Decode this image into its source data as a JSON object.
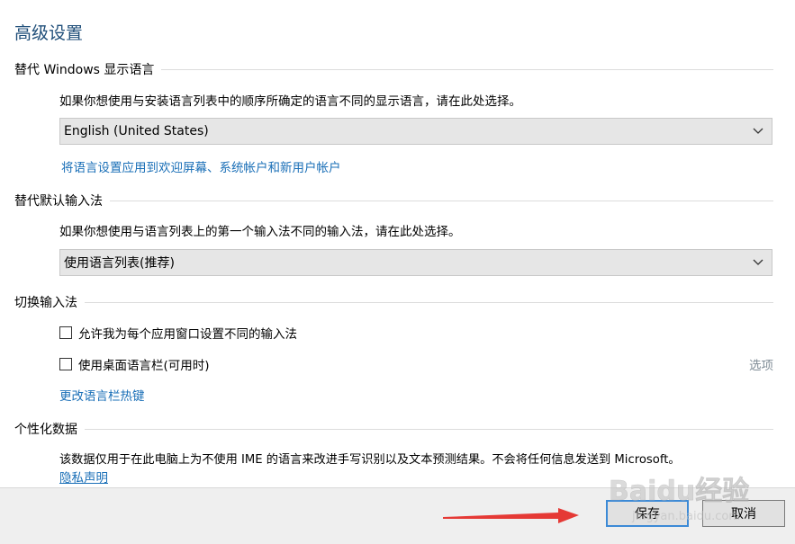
{
  "page": {
    "title": "高级设置"
  },
  "display_language": {
    "header": "替代 Windows 显示语言",
    "description": "如果你想使用与安装语言列表中的顺序所确定的语言不同的显示语言，请在此处选择。",
    "selected": "English (United States)",
    "apply_link": "将语言设置应用到欢迎屏幕、系统帐户和新用户帐户"
  },
  "default_input": {
    "header": "替代默认输入法",
    "description": "如果你想使用与语言列表上的第一个输入法不同的输入法，请在此处选择。",
    "selected": "使用语言列表(推荐)"
  },
  "switch_input": {
    "header": "切换输入法",
    "option1_label": "允许我为每个应用窗口设置不同的输入法",
    "option1_checked": false,
    "option2_label": "使用桌面语言栏(可用时)",
    "option2_checked": false,
    "options_link": "选项",
    "hotkey_link": "更改语言栏热键"
  },
  "personalization": {
    "header": "个性化数据",
    "description": "该数据仅用于在此电脑上为不使用 IME 的语言来改进手写识别以及文本预测结果。不会将任何信息发送到 Microsoft。",
    "privacy_link": "隐私声明"
  },
  "footer": {
    "save_label": "保存",
    "cancel_label": "取消"
  },
  "watermark": {
    "text": "Baidu经验",
    "url": "jingyan.baidu.com"
  },
  "colors": {
    "title": "#1f4e79",
    "link": "#1a6fb7",
    "primary_border": "#3c8ad6",
    "arrow": "#e53935"
  }
}
